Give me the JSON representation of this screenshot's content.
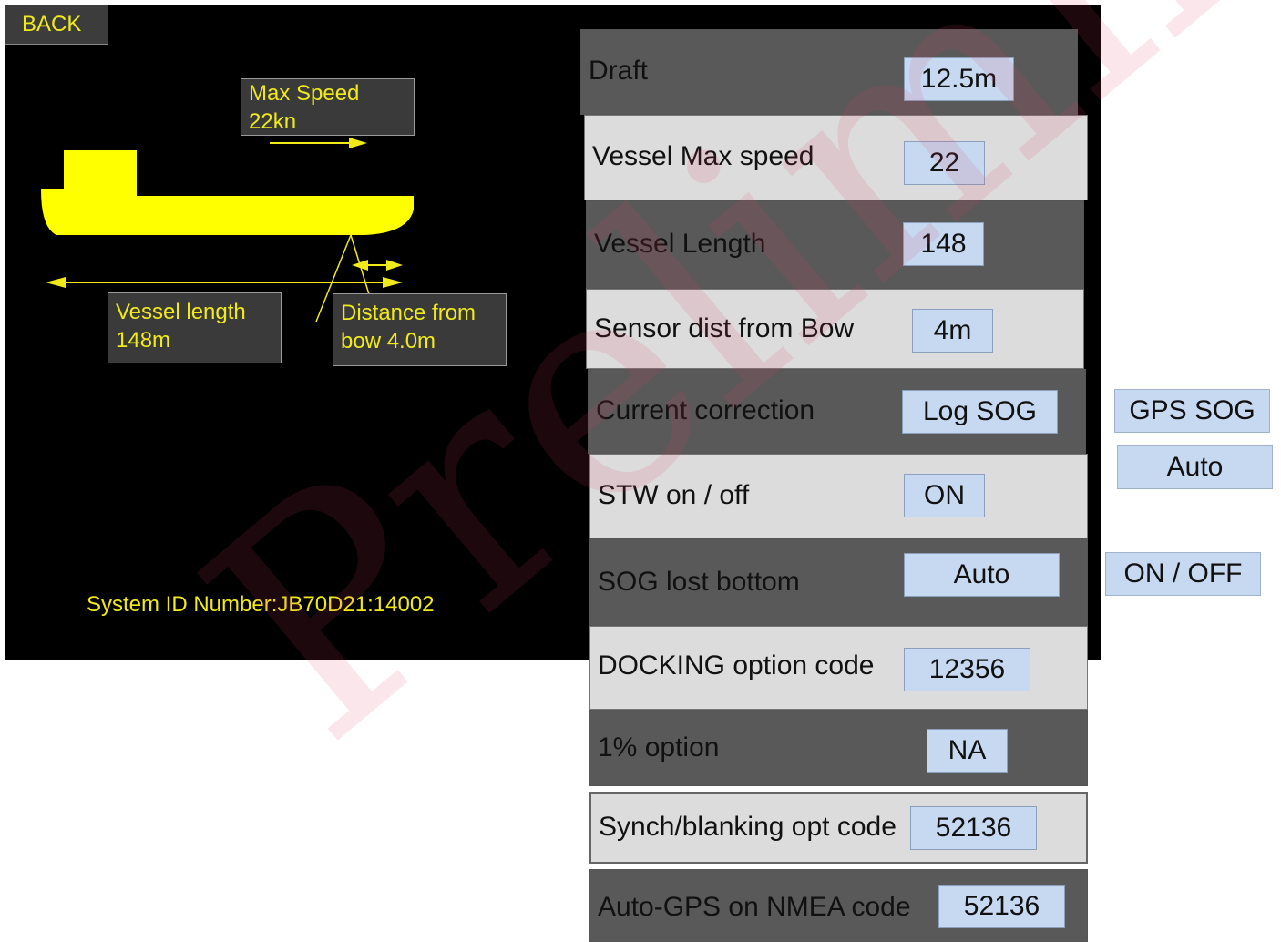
{
  "header": {
    "back_label": "BACK"
  },
  "diagram": {
    "max_speed_label": "Max Speed",
    "max_speed_value": "22kn",
    "vessel_length_label": "Vessel length",
    "vessel_length_value": "148m",
    "distance_label": "Distance from",
    "distance_value": "bow 4.0m",
    "ship_color": "#ffff00"
  },
  "system_id": "System ID Number:JB70D21:14002",
  "settings": [
    {
      "label": "Draft",
      "value": "12.5m"
    },
    {
      "label": "Vessel Max speed",
      "value": "22"
    },
    {
      "label": "Vessel Length",
      "value": "148"
    },
    {
      "label": "Sensor dist from Bow",
      "value": "4m"
    },
    {
      "label": "Current correction",
      "value": "Log SOG"
    },
    {
      "label": "STW on / off",
      "value": "ON"
    },
    {
      "label": "SOG lost bottom",
      "value": "Auto"
    },
    {
      "label": "DOCKING option code",
      "value": "12356"
    },
    {
      "label": "1% option",
      "value": "NA"
    },
    {
      "label": "Synch/blanking opt code",
      "value": "52136"
    },
    {
      "label": "Auto-GPS on NMEA code",
      "value": "52136"
    }
  ],
  "current_correction_options": [
    "GPS SOG",
    "Auto"
  ],
  "sog_lost_bottom_options": [
    "ON / OFF"
  ],
  "watermark": "Preliminary",
  "colors": {
    "accent_text": "#f1ea1a",
    "value_box": "#c6d9f1",
    "panel": "#000000"
  }
}
